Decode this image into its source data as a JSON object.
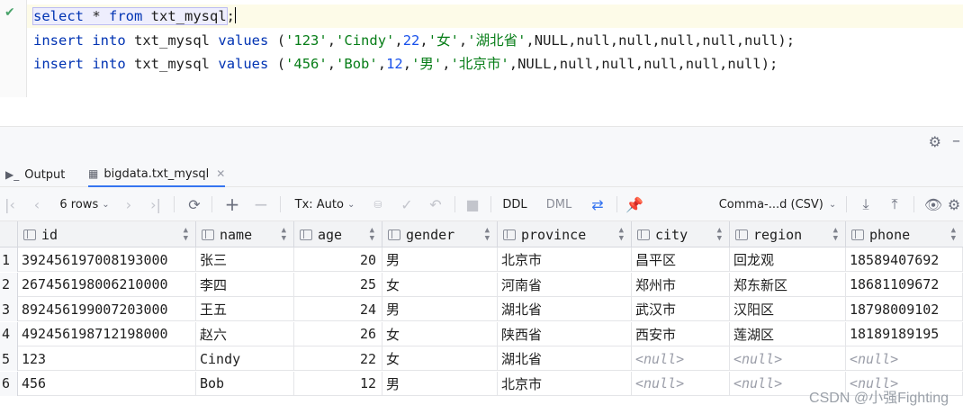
{
  "editor": {
    "lines": [
      {
        "kw1": "select",
        "rest1": " * ",
        "kw2": "from",
        "rest2": " txt_mysql",
        "end": ";"
      },
      {
        "kw1": "insert",
        "kw2": "into",
        "table": "txt_mysql",
        "kw3": "values",
        "open": " (",
        "s1": "'123'",
        "s2": "'Cindy'",
        "n1": "22",
        "s3": "'女'",
        "s4": "'湖北省'",
        "tail": ",NULL,null,null,null,null,null);"
      },
      {
        "kw1": "insert",
        "kw2": "into",
        "table": "txt_mysql",
        "kw3": "values",
        "open": " (",
        "s1": "'456'",
        "s2": "'Bob'",
        "n1": "12",
        "s3": "'男'",
        "s4": "'北京市'",
        "tail": ",NULL,null,null,null,null,null);"
      }
    ]
  },
  "tabs": {
    "output_label": "Output",
    "table_label": "bigdata.txt_mysql"
  },
  "toolbar": {
    "rows_label": "6 rows",
    "tx_label": "Tx: Auto",
    "ddl_label": "DDL",
    "dml_label": "DML",
    "export_format": "Comma-...d (CSV)"
  },
  "columns": [
    "id",
    "name",
    "age",
    "gender",
    "province",
    "city",
    "region",
    "phone"
  ],
  "rows": [
    {
      "n": "1",
      "id": "392456197008193000",
      "name": "张三",
      "age": "20",
      "gender": "男",
      "province": "北京市",
      "city": "昌平区",
      "region": "回龙观",
      "phone": "18589407692"
    },
    {
      "n": "2",
      "id": "267456198006210000",
      "name": "李四",
      "age": "25",
      "gender": "女",
      "province": "河南省",
      "city": "郑州市",
      "region": "郑东新区",
      "phone": "18681109672"
    },
    {
      "n": "3",
      "id": "892456199007203000",
      "name": "王五",
      "age": "24",
      "gender": "男",
      "province": "湖北省",
      "city": "武汉市",
      "region": "汉阳区",
      "phone": "18798009102"
    },
    {
      "n": "4",
      "id": "492456198712198000",
      "name": "赵六",
      "age": "26",
      "gender": "女",
      "province": "陕西省",
      "city": "西安市",
      "region": "莲湖区",
      "phone": "18189189195"
    },
    {
      "n": "5",
      "id": "123",
      "name": "Cindy",
      "age": "22",
      "gender": "女",
      "province": "湖北省",
      "city": "<null>",
      "region": "<null>",
      "phone": "<null>"
    },
    {
      "n": "6",
      "id": "456",
      "name": "Bob",
      "age": "12",
      "gender": "男",
      "province": "北京市",
      "city": "<null>",
      "region": "<null>",
      "phone": "<null>"
    }
  ],
  "watermark": "CSDN @小强Fighting"
}
